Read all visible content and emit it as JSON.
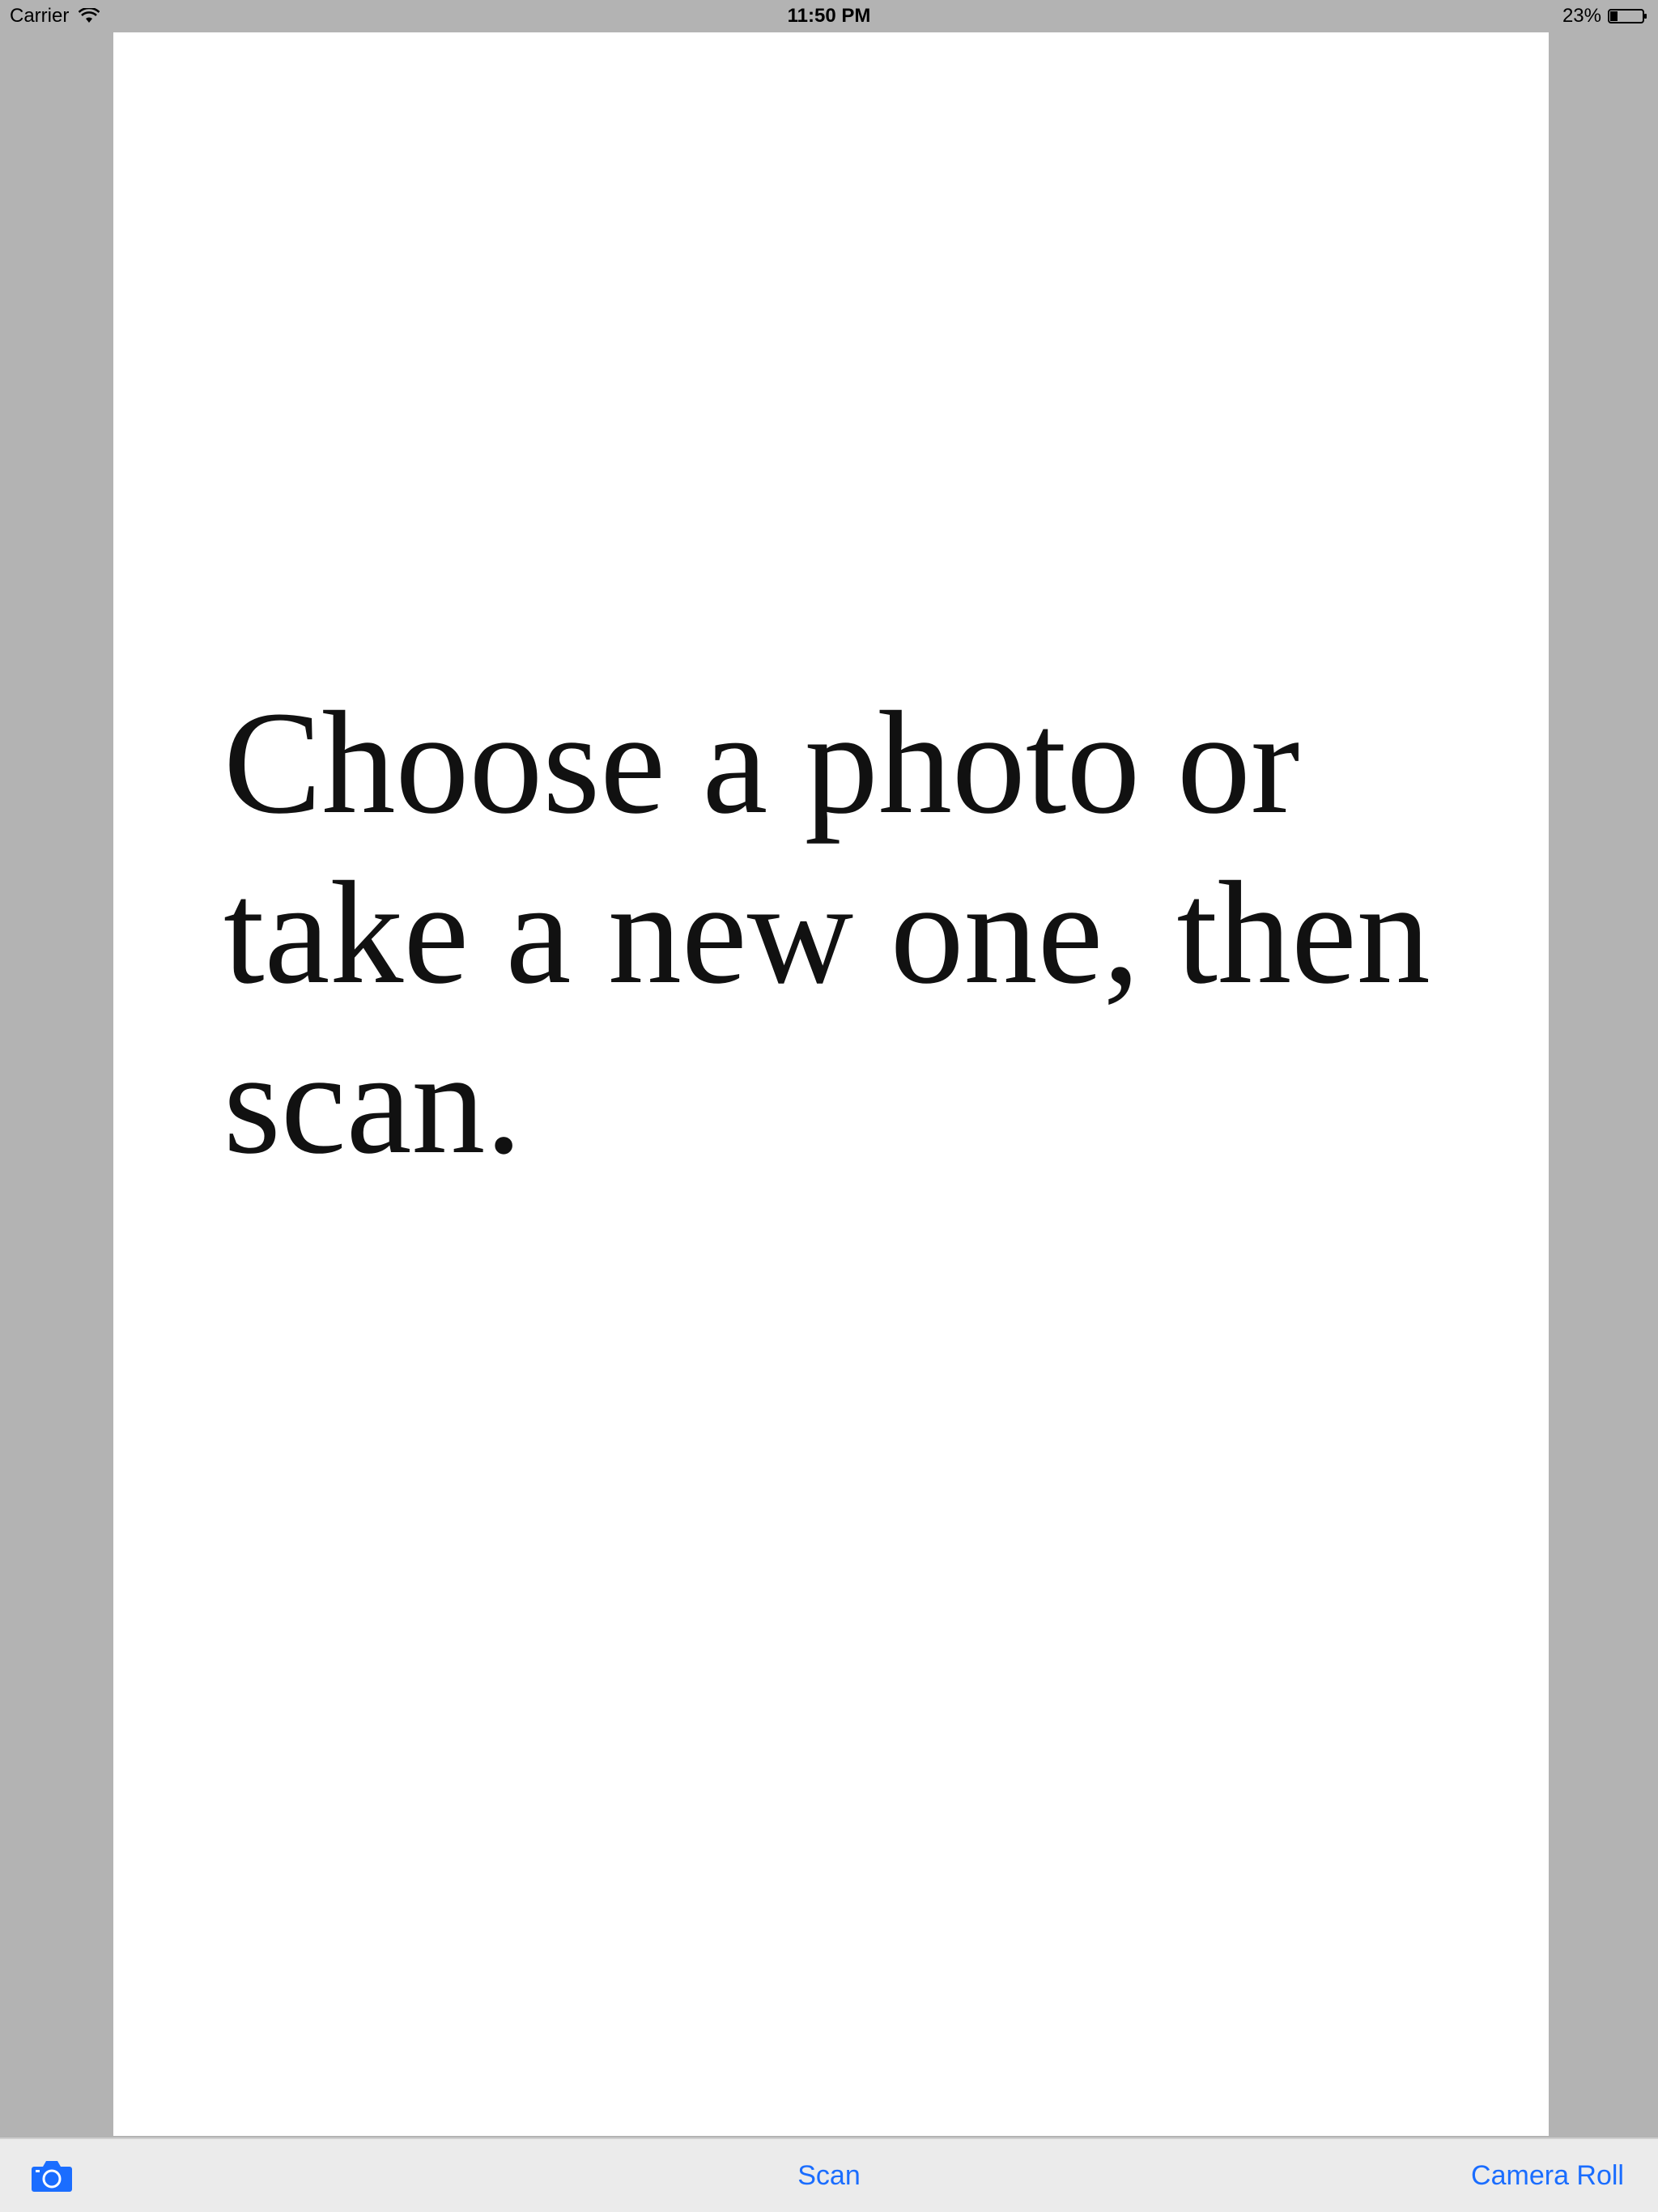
{
  "status_bar": {
    "carrier": "Carrier",
    "time": "11:50 PM",
    "battery": "23%",
    "battery_level": 0.23,
    "icons": [
      "wifi-icon",
      "battery-icon"
    ]
  },
  "document": {
    "message": "Choose a photo or take a new one, then scan."
  },
  "toolbar": {
    "camera_icon": "camera-icon",
    "scan_label": "Scan",
    "camera_roll_label": "Camera Roll",
    "accent_color": "#1a6dff"
  }
}
